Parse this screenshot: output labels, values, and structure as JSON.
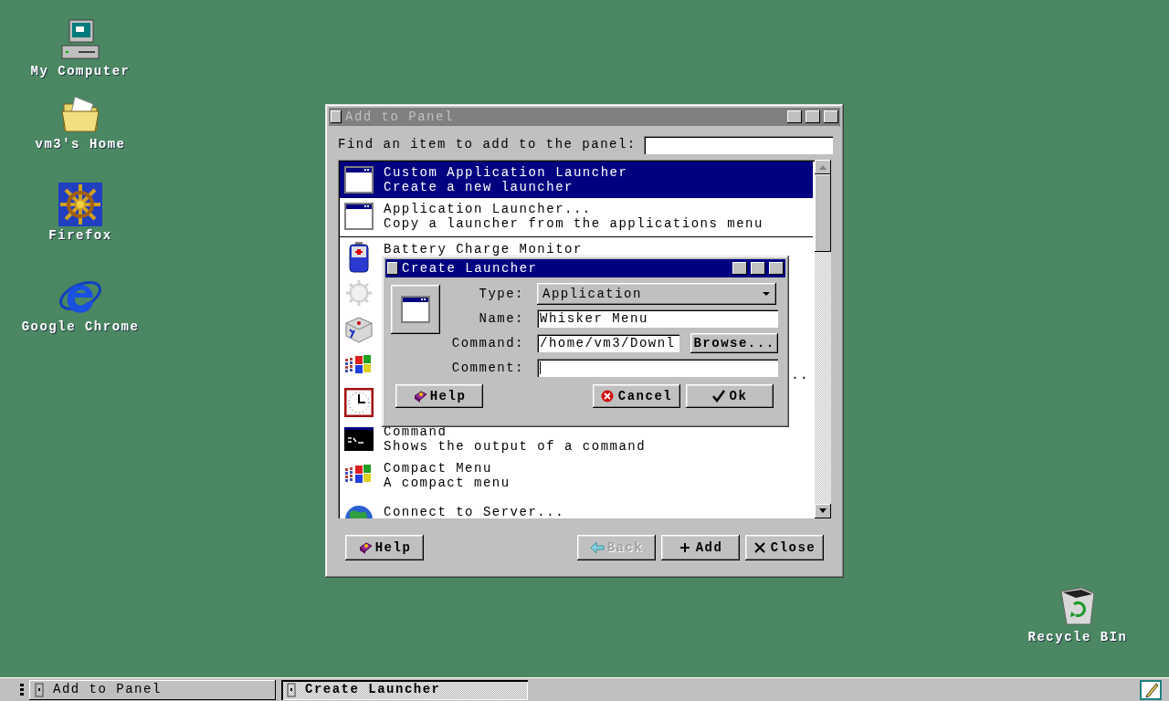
{
  "desktop_icons": [
    {
      "label": "My Computer",
      "kind": "computer"
    },
    {
      "label": "vm3's Home",
      "kind": "folder"
    },
    {
      "label": "Firefox",
      "kind": "wheel"
    },
    {
      "label": "Google Chrome",
      "kind": "globe-e"
    },
    {
      "label": "Recycle BIn",
      "kind": "trash"
    }
  ],
  "add_panel": {
    "title": "Add to Panel",
    "active": false,
    "search_label": "Find an item to add to the panel:",
    "launcher_items": [
      {
        "title": "Custom Application Launcher",
        "description": "Create a new launcher",
        "kind": "window",
        "selected": true
      },
      {
        "title": "Application Launcher...",
        "description": "Copy a launcher from the applications menu",
        "kind": "window",
        "selected": false
      }
    ],
    "plugin_items": [
      {
        "title": "Battery Charge Monitor",
        "kind": "battery"
      },
      {
        "kind": "gear"
      },
      {
        "kind": "cube"
      },
      {
        "kind": "flag",
        "tail": ".."
      },
      {
        "kind": "clock"
      },
      {
        "title": "Command",
        "description": "Shows the output of a command",
        "kind": "terminal"
      },
      {
        "title": "Compact Menu",
        "description": "A compact menu",
        "kind": "flag"
      },
      {
        "title": "Connect to Server...",
        "kind": "globe"
      }
    ],
    "buttons": [
      {
        "label": "Help",
        "kind": "help",
        "disabled": false
      },
      {
        "label": "Back",
        "kind": "back",
        "disabled": true
      },
      {
        "label": "Add",
        "kind": "add",
        "disabled": false
      },
      {
        "label": "Close",
        "kind": "close",
        "disabled": false
      }
    ]
  },
  "dialog": {
    "title": "Create Launcher",
    "active": true,
    "fields": [
      {
        "label": "Type:",
        "kind": "select",
        "value": "Application"
      },
      {
        "label": "Name:",
        "kind": "text",
        "value": "Whisker Menu"
      },
      {
        "label": "Command:",
        "kind": "browse",
        "value": "/home/vm3/Downl",
        "button": "Browse..."
      },
      {
        "label": "Comment:",
        "kind": "text"
      }
    ],
    "buttons": [
      {
        "label": "Help",
        "kind": "help"
      },
      {
        "label": "Cancel",
        "kind": "cancel"
      },
      {
        "label": "Ok",
        "kind": "ok"
      }
    ]
  },
  "taskbar": {
    "tasks": [
      {
        "label": "Add to Panel",
        "selected": false
      },
      {
        "label": "Create Launcher",
        "selected": true
      }
    ]
  }
}
